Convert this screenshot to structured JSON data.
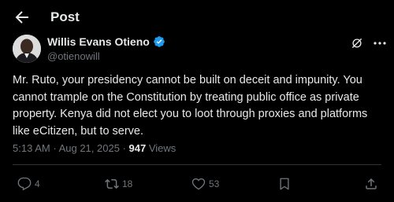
{
  "header": {
    "title": "Post"
  },
  "author": {
    "name": "Willis Evans Otieno",
    "handle": "@otienowill"
  },
  "post": {
    "text": "Mr. Ruto, your presidency cannot be built on deceit and impunity. You cannot trample on the Constitution by treating public office as private property. Kenya did not elect you to loot through proxies and platforms like eCitizen, but to serve.",
    "time": "5:13 AM",
    "date": "Aug 21, 2025",
    "separator": "·",
    "views_count": "947",
    "views_label": "Views"
  },
  "actions": {
    "replies": "4",
    "reposts": "18",
    "likes": "53"
  },
  "colors": {
    "background": "#000000",
    "text_primary": "#e7e9ea",
    "text_secondary": "#71767b",
    "verified": "#1d9bf0",
    "divider": "#2f3336"
  }
}
